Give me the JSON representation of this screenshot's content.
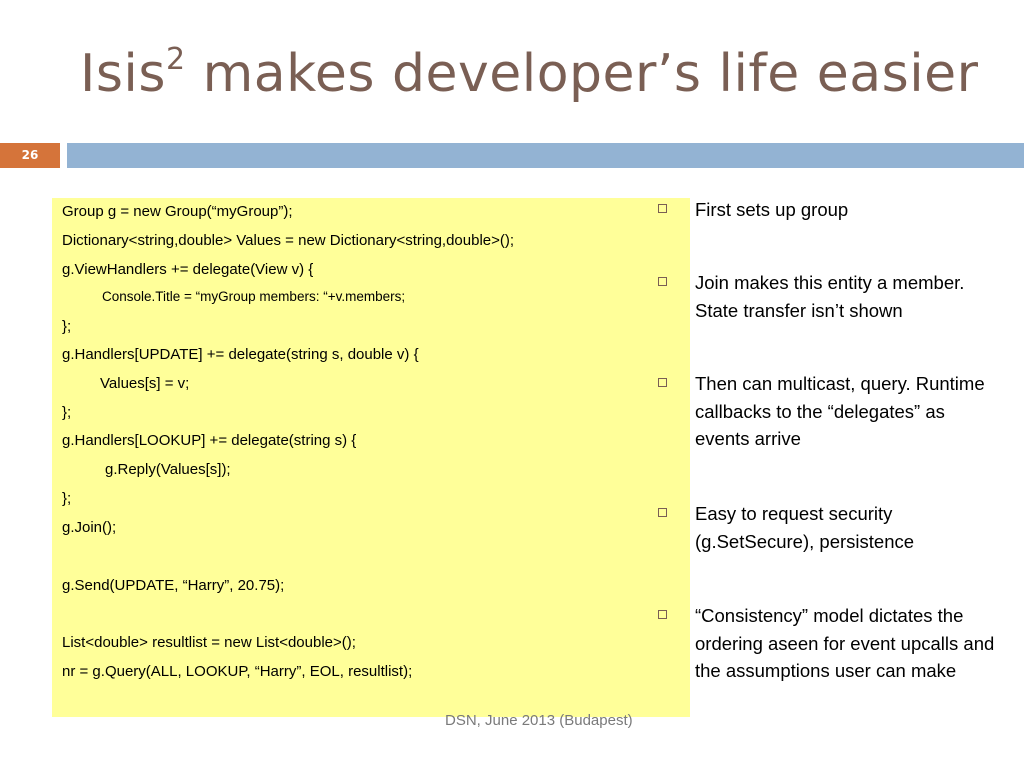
{
  "slide": {
    "title_main": "Isis",
    "title_sup": "2",
    "title_rest": " makes developer’s life easier",
    "slide_number": "26",
    "footer": "DSN, June 2013 (Budapest)"
  },
  "code": {
    "lines": [
      "Group g = new Group(“myGroup”);",
      "Dictionary<string,double> Values = new Dictionary<string,double>();",
      "g.ViewHandlers += delegate(View v) {",
      "Console.Title = “myGroup members: “+v.members;",
      "};",
      "g.Handlers[UPDATE] += delegate(string s, double v) {",
      "Values[s] = v;",
      "};",
      "g.Handlers[LOOKUP] += delegate(string s) {",
      "g.Reply(Values[s]);",
      "};",
      "g.Join();",
      "g.Send(UPDATE, “Harry”, 20.75);",
      "List<double> resultlist = new List<double>();",
      "nr = g.Query(ALL, LOOKUP, “Harry”, EOL, resultlist);"
    ]
  },
  "bullets": [
    "First sets up group",
    "Join makes this entity a member. State transfer isn’t shown",
    "Then can multicast, query. Runtime callbacks to the “delegates” as events arrive",
    "Easy to request security (g.SetSecure), persistence",
    "“Consistency” model dictates the ordering aseen for event upcalls and the assumptions user can make"
  ],
  "colors": {
    "title": "#7a5f54",
    "slide_number_bg": "#d5743a",
    "header_bar": "#93b3d3",
    "code_bg": "#ffff99",
    "footer_text": "#7a7a7a"
  }
}
